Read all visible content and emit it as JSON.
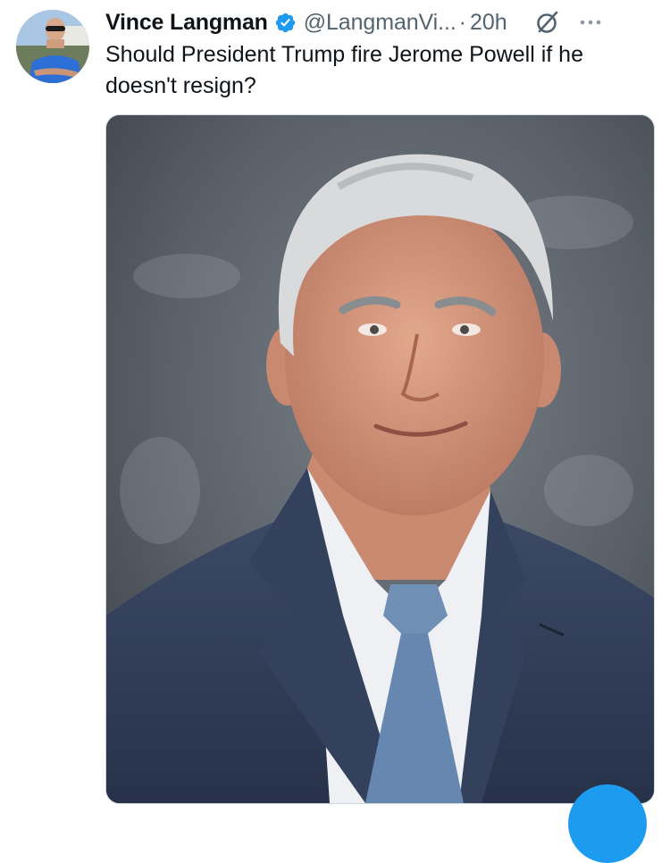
{
  "tweet": {
    "author_name": "Vince Langman",
    "handle": "@LangmanVi...",
    "separator": "·",
    "timestamp": "20h",
    "text": "Should President Trump fire Jerome Powell if he doesn't resign?"
  },
  "icons": {
    "verified": "verified-badge-icon",
    "grok": "grok-icon",
    "more": "more-options-icon"
  },
  "colors": {
    "accent": "#1d9bf0",
    "text_primary": "#0f1419",
    "text_secondary": "#536471"
  }
}
